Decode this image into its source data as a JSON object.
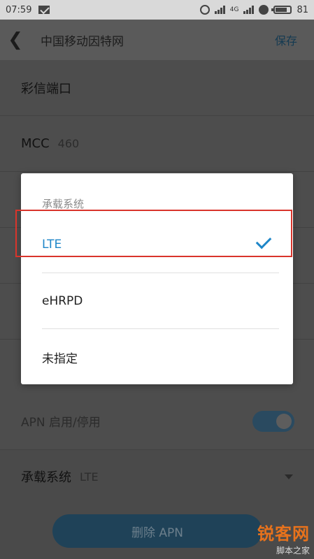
{
  "status": {
    "time": "07:59",
    "signal_text": "4G",
    "battery": "81"
  },
  "app_bar": {
    "title": "中国移动因特网",
    "save_label": "保存"
  },
  "settings": [
    {
      "label": "彩信端口",
      "value": ""
    },
    {
      "label": "MCC",
      "value": "460"
    },
    {
      "label": "",
      "value": ""
    },
    {
      "label": "",
      "value": ""
    },
    {
      "label": "",
      "value": ""
    },
    {
      "label": "",
      "value": ""
    }
  ],
  "apn_toggle": {
    "label": "APN 启用/停用",
    "enabled": true
  },
  "bearer": {
    "label": "承载系统",
    "value": "LTE"
  },
  "delete_button": {
    "label": "删除 APN"
  },
  "dialog": {
    "title": "承载系统",
    "options": [
      {
        "label": "LTE",
        "selected": true
      },
      {
        "label": "eHRPD",
        "selected": false
      },
      {
        "label": "未指定",
        "selected": false
      }
    ]
  },
  "watermark": {
    "main": "锐客网",
    "sub": "脚本之家"
  },
  "colors": {
    "accent": "#1e86c8",
    "highlight": "#d9342b"
  }
}
